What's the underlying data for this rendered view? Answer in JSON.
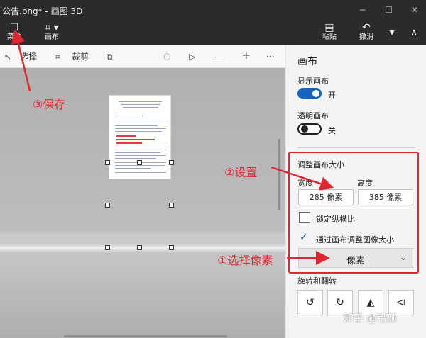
{
  "window": {
    "title": "公告.png* - 画图 3D",
    "minimize": "─",
    "maximize": "☐",
    "close": "✕"
  },
  "toolbar": {
    "menu_label": "菜单",
    "menu_icon": "☐",
    "canvas_label": "画布",
    "canvas_icon": "⌗ ▾",
    "paste_label": "粘贴",
    "paste_icon": "▤",
    "undo_label": "撤消",
    "undo_icon": "↶",
    "expand_icon": "▾",
    "collapse_icon": "∧"
  },
  "subtoolbar": {
    "select_icon": "↖",
    "select_label": "选择",
    "crop_icon": "⌗",
    "crop_label": "裁剪",
    "magic_icon": "⧉",
    "shape_icon": "⬡",
    "sticker_icon": "▷",
    "zoom_out": "—",
    "zoom_in": "+",
    "more": "···"
  },
  "panel": {
    "title": "画布",
    "show_canvas": {
      "label": "显示画布",
      "state": "开",
      "on": true
    },
    "transparent_canvas": {
      "label": "透明画布",
      "state": "关",
      "on": false
    },
    "resize": {
      "title": "调整画布大小",
      "width_label": "宽度",
      "height_label": "高度",
      "width_value": "285 像素",
      "height_value": "385 像素",
      "lock_aspect_label": "锁定纵横比",
      "resize_image_label": "通过画布调整图像大小",
      "check_mark": "✓",
      "unit_value": "像素",
      "unit_chevron": "⌄"
    },
    "rotate": {
      "title": "旋转和翻转",
      "rotate_left": "↺",
      "rotate_right": "↻",
      "flip_vertical": "◭",
      "flip_horizontal": "⧏"
    }
  },
  "annotations": {
    "save": "③保存",
    "settings": "②设置",
    "select_pixels": "①选择像素"
  },
  "watermark": "知乎 @铅颜",
  "colors": {
    "accent": "#1565c0",
    "annotation": "#e0262f",
    "titlebar": "#2b2b2b"
  }
}
